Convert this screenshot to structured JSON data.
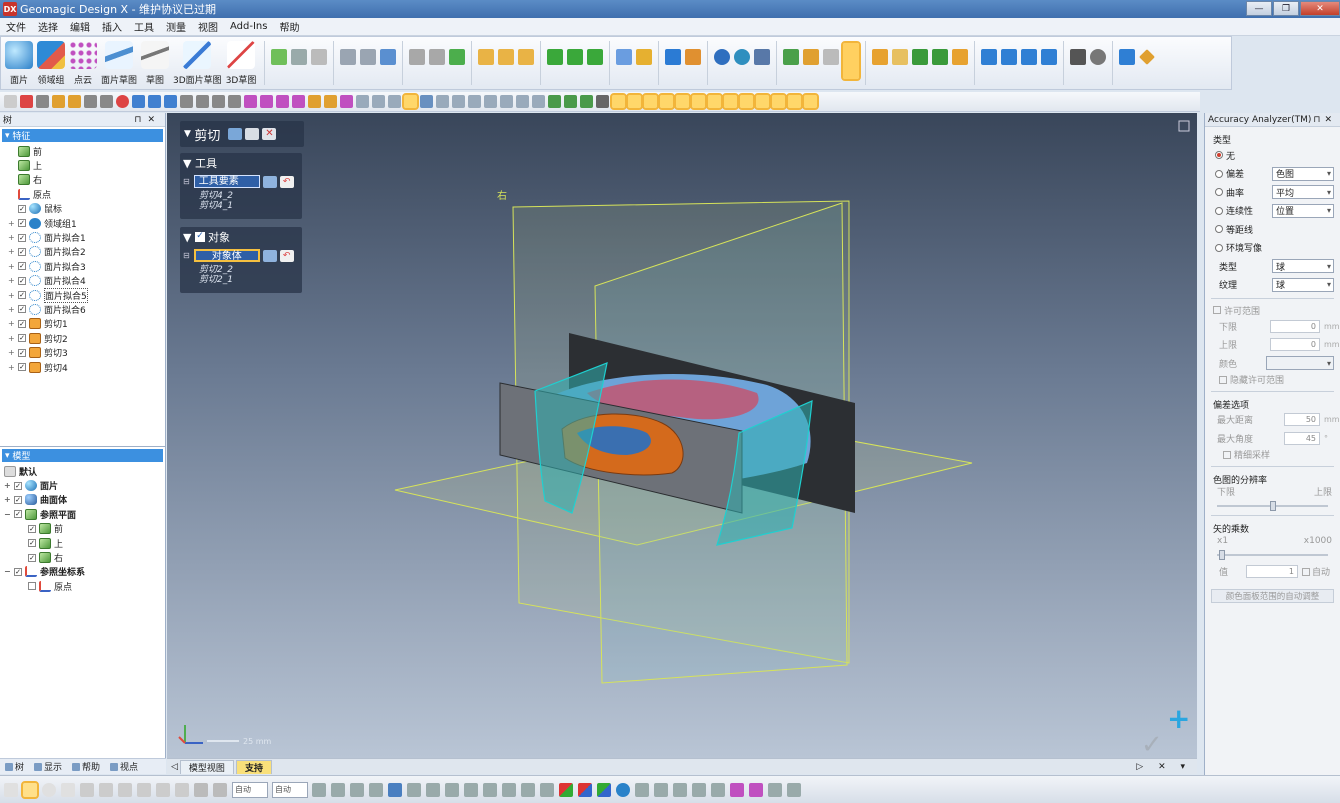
{
  "window": {
    "title": "Geomagic Design X - 维护协议已过期",
    "app_icon_text": "DX",
    "buttons": [
      "—",
      "❐",
      "✕"
    ]
  },
  "menu": [
    "文件",
    "选择",
    "编辑",
    "插入",
    "工具",
    "测量",
    "视图",
    "Add-Ins",
    "帮助"
  ],
  "ribbon": {
    "buttons": [
      "面片",
      "领域组",
      "点云",
      "面片草图",
      "草图",
      "3D面片草图",
      "3D草图"
    ]
  },
  "tree_panel": {
    "title": "树",
    "root": "特征",
    "items": [
      "前",
      "上",
      "右",
      "原点",
      "鼠标",
      "领域组1",
      "面片拟合1",
      "面片拟合2",
      "面片拟合3",
      "面片拟合4",
      "面片拟合5",
      "面片拟合6",
      "剪切1",
      "剪切2",
      "剪切3",
      "剪切4"
    ]
  },
  "model_panel": {
    "root": "模型",
    "items": [
      "默认",
      "面片",
      "曲面体",
      "参照平面",
      "前",
      "上",
      "右",
      "参照坐标系",
      "原点"
    ]
  },
  "left_tabs": [
    "树",
    "显示",
    "帮助",
    "视点"
  ],
  "viewport": {
    "tabs": [
      "模型视图",
      "支持"
    ],
    "tab_controls": "▷ ✕ ▾",
    "plane_label": "右",
    "scale_label": "25 mm"
  },
  "cut_dialog": {
    "title": "剪切",
    "tool_section": "工具",
    "tool_field": "工具要素",
    "tool_items": [
      "剪切4_2",
      "剪切4_1"
    ],
    "target_section": "对象",
    "target_field": "对象体",
    "target_items": [
      "剪切2_2",
      "剪切2_1"
    ]
  },
  "accuracy": {
    "title": "Accuracy Analyzer(TM)",
    "type_label": "类型",
    "options": [
      "无",
      "偏差",
      "曲率",
      "连续性",
      "等距线",
      "环境写像"
    ],
    "selected": "无",
    "dropdowns": {
      "偏差": "色图",
      "曲率": "平均",
      "连续性": "位置"
    },
    "sub_type_label": "类型",
    "sub_type_value": "球",
    "texture_label": "纹理",
    "texture_value": "球",
    "tolerance_section": "许可范围",
    "lower_label": "下限",
    "lower_value": "0",
    "upper_label": "上限",
    "upper_value": "0",
    "unit": "mm",
    "color_label": "颜色",
    "hide_tolerance": "隐藏许可范围",
    "deviation_section": "偏差选项",
    "max_distance_label": "最大距离",
    "max_distance": "50",
    "max_angle_label": "最大角度",
    "max_angle": "45",
    "angle_unit": "°",
    "fine_sampling": "精细采样",
    "resolution_section": "色图的分辨率",
    "res_low": "下限",
    "res_high": "上限",
    "scale_section": "矢的乘数",
    "scale_min": "x1",
    "scale_max": "x1000",
    "value_label": "值",
    "value": "1",
    "auto_label": "自动",
    "auto_adjust_button": "颜色面板范围的自动调整"
  },
  "status": {
    "select_1": "自动",
    "select_2": "自动"
  },
  "colors": {
    "accent": "#3c90e0",
    "active": "#f2b53a",
    "surface_cyan": "#2fb0b0",
    "plane_yellow": "#d6e35a"
  }
}
